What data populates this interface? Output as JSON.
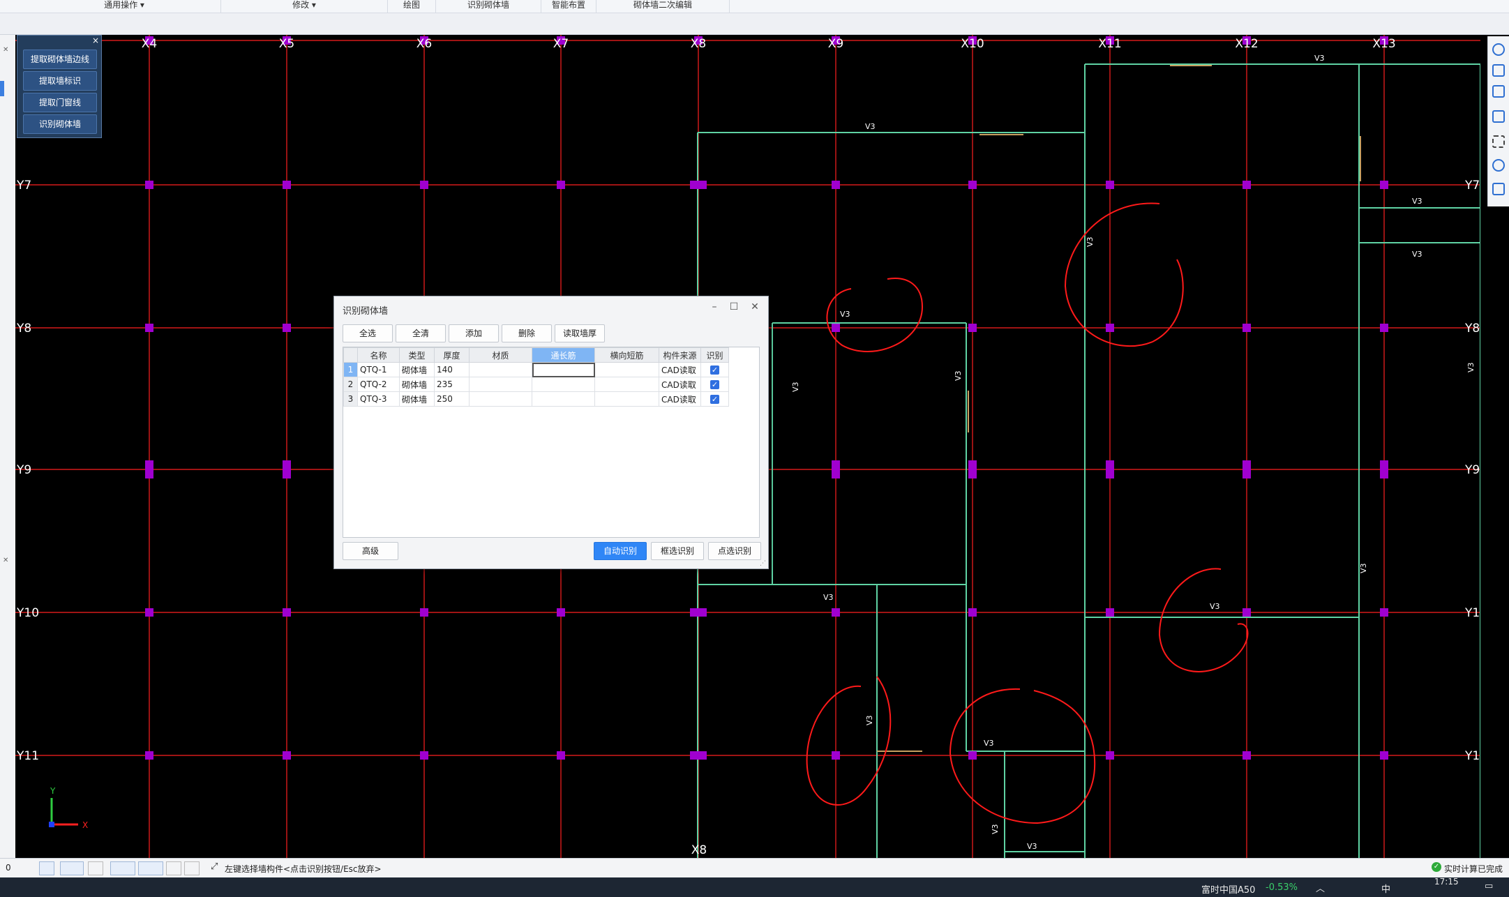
{
  "ribbon": {
    "groups": [
      "通用操作",
      "修改",
      "绘图",
      "识别砌体墙",
      "智能布置",
      "砌体墙二次编辑"
    ]
  },
  "tool_panel": {
    "buttons": [
      "提取砌体墙边线",
      "提取墙标识",
      "提取门窗线",
      "识别砌体墙"
    ],
    "close": "×"
  },
  "canvas": {
    "x_axes": [
      "X4",
      "X5",
      "X6",
      "X7",
      "X8",
      "X9",
      "X10",
      "X11",
      "X12",
      "X13"
    ],
    "y_axes": [
      "Y7",
      "Y8",
      "Y9",
      "Y10",
      "Y11"
    ],
    "bottom_axis_label": "X8",
    "wall_tag": "V3",
    "ucs_x": "X",
    "ucs_y": "Y"
  },
  "dialog": {
    "title": "识别砌体墙",
    "controls": {
      "minimize": "–",
      "maximize": "☐",
      "close": "✕"
    },
    "toolbar": {
      "select_all": "全选",
      "clear_all": "全清",
      "add": "添加",
      "delete": "删除",
      "read_thickness": "读取墙厚"
    },
    "columns": [
      "名称",
      "类型",
      "厚度",
      "材质",
      "通长筋",
      "横向短筋",
      "构件来源",
      "识别"
    ],
    "rows": [
      {
        "index": "1",
        "name": "QTQ-1",
        "type": "砌体墙",
        "thickness": "140",
        "material": "",
        "long_bar": "",
        "short_bar": "",
        "source": "CAD读取",
        "recognize": "✓"
      },
      {
        "index": "2",
        "name": "QTQ-2",
        "type": "砌体墙",
        "thickness": "235",
        "material": "",
        "long_bar": "",
        "short_bar": "",
        "source": "CAD读取",
        "recognize": "✓"
      },
      {
        "index": "3",
        "name": "QTQ-3",
        "type": "砌体墙",
        "thickness": "250",
        "material": "",
        "long_bar": "",
        "short_bar": "",
        "source": "CAD读取",
        "recognize": "✓"
      }
    ],
    "footer": {
      "advanced": "高级",
      "auto_recognize": "自动识别",
      "box_recognize": "框选识别",
      "point_recognize": "点选识别"
    }
  },
  "statusbar": {
    "left_value": "0",
    "hint": "左键选择墙构件<点击识别按钮/Esc放弃>",
    "calc_status": "实时计算已完成"
  },
  "taskbar": {
    "stock_name": "富时中国A50",
    "stock_change": "-0.53%",
    "ime": "中",
    "time": "17:15"
  },
  "colors": {
    "axis_line": "#ff2020",
    "wall_line": "#5fd3a4",
    "column": "#a000d0",
    "annotation": "#ff1a1a",
    "primary_button": "#2f86f6"
  }
}
